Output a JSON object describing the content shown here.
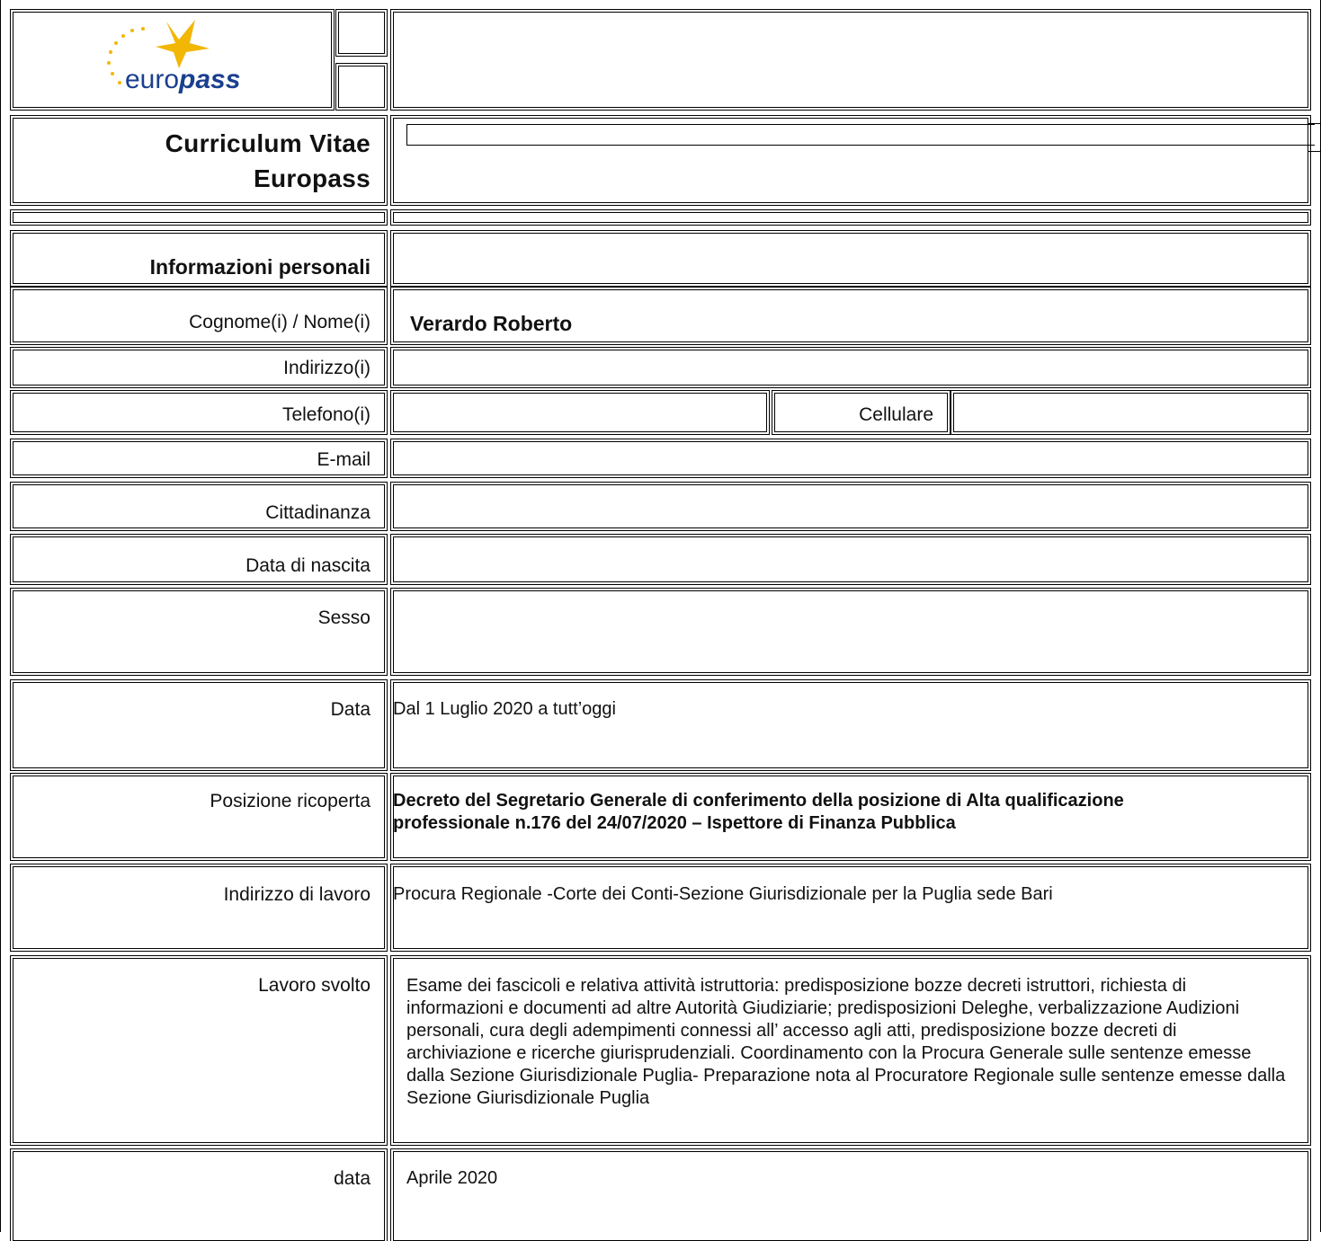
{
  "header": {
    "logo_text_euro": "euro",
    "logo_text_pass": "pass",
    "title_line1": "Curriculum Vitae",
    "title_line2": "Europass"
  },
  "personal": {
    "section_title": "Informazioni personali",
    "name_label": "Cognome(i) / Nome(i)",
    "name_value": "Verardo Roberto",
    "address_label": "Indirizzo(i)",
    "address_value": "",
    "phone_label": "Telefono(i)",
    "phone_value": "",
    "mobile_label": "Cellulare",
    "mobile_value": "",
    "email_label": "E-mail",
    "email_value": "",
    "citizenship_label": "Cittadinanza",
    "citizenship_value": "",
    "birthdate_label": "Data di nascita",
    "birthdate_value": "",
    "sex_label": "Sesso",
    "sex_value": ""
  },
  "experience": [
    {
      "date_label": "Data",
      "date_value": "Dal  1 Luglio 2020 a tutt’oggi",
      "position_label": "Posizione ricoperta",
      "position_value": "Decreto del Segretario Generale di conferimento della posizione di  Alta qualificazione professionale n.176 del 24/07/2020 – Ispettore di Finanza Pubblica",
      "workplace_label": "Indirizzo di lavoro",
      "workplace_value": "Procura Regionale -Corte dei Conti-Sezione Giurisdizionale per la Puglia sede Bari",
      "duties_label": "Lavoro svolto",
      "duties_value": "Esame dei fascicoli e relativa attività istruttoria: predisposizione bozze decreti istruttori, richiesta di informazioni e documenti ad altre Autorità Giudiziarie; predisposizioni Deleghe, verbalizzazione Audizioni personali, cura degli adempimenti connessi all’ accesso agli atti, predisposizione  bozze decreti di archiviazione e ricerche giurisprudenziali. Coordinamento con la Procura Generale sulle sentenze emesse dalla Sezione Giurisdizionale Puglia- Preparazione nota al Procuratore Regionale sulle sentenze emesse dalla Sezione Giurisdizionale Puglia"
    },
    {
      "date_label": "data",
      "date_value": "Aprile 2020"
    }
  ],
  "colors": {
    "logo_blue": "#1a3f8f",
    "logo_yellow": "#f2b705",
    "border": "#000000"
  }
}
